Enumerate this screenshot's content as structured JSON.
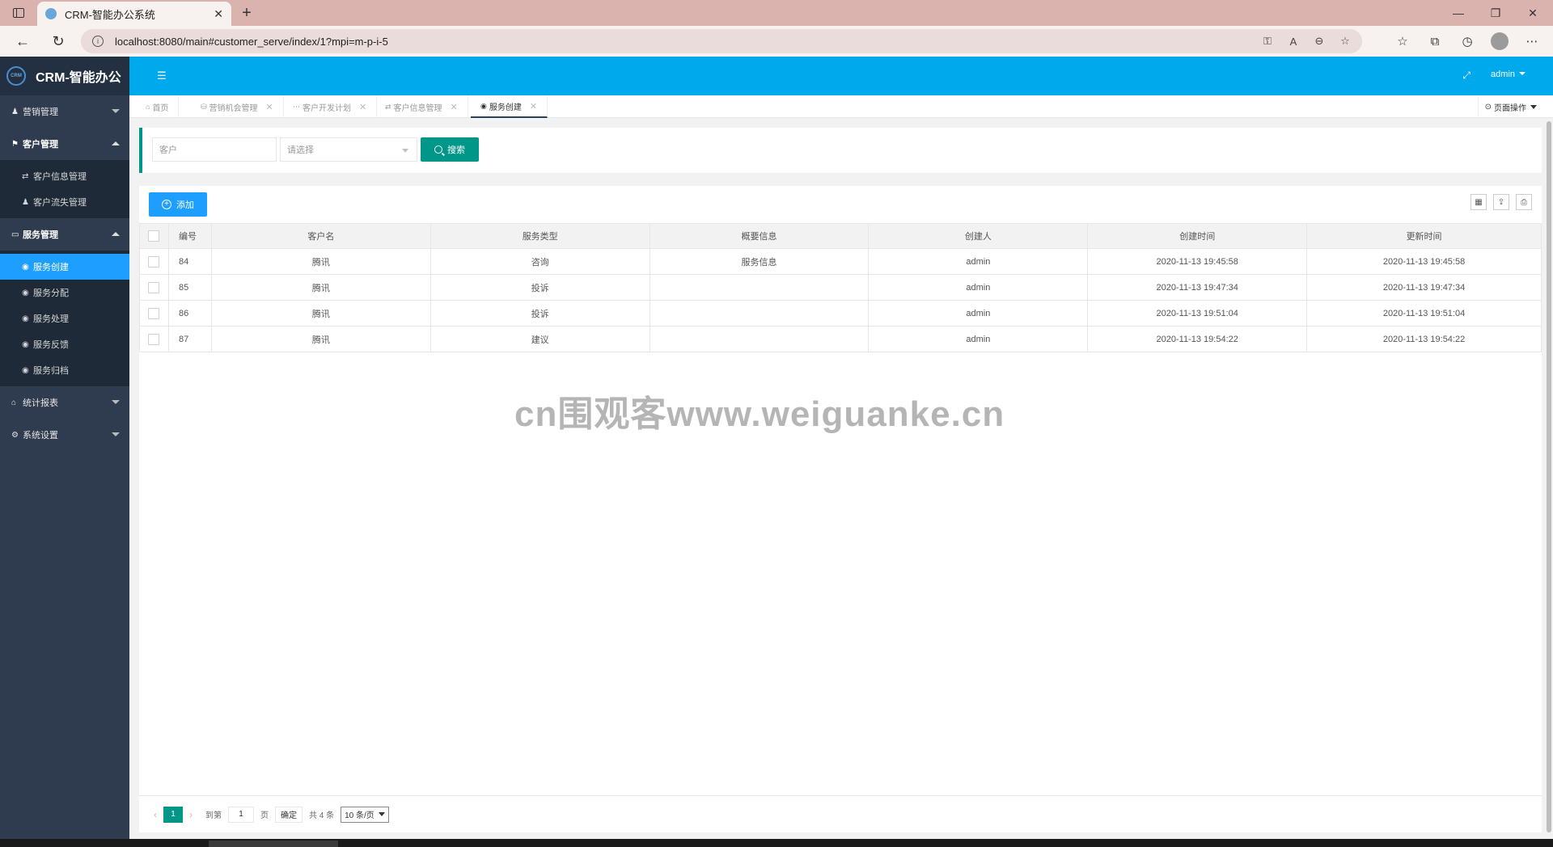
{
  "browser": {
    "tab_title": "CRM-智能办公系统",
    "url": "localhost:8080/main#customer_serve/index/1?mpi=m-p-i-5"
  },
  "app": {
    "logo_text": "CRM-智能办公",
    "logo_mark": "CRM",
    "user": "admin"
  },
  "sidebar": {
    "groups": [
      {
        "label": "营销管理",
        "icon": "user-icon"
      },
      {
        "label": "客户管理",
        "icon": "flag-icon",
        "items": [
          "客户信息管理",
          "客户流失管理"
        ]
      },
      {
        "label": "服务管理",
        "icon": "monitor-icon",
        "items": [
          "服务创建",
          "服务分配",
          "服务处理",
          "服务反馈",
          "服务归档"
        ]
      },
      {
        "label": "统计报表",
        "icon": "home-icon"
      },
      {
        "label": "系统设置",
        "icon": "gears-icon"
      }
    ],
    "active_item": "服务创建"
  },
  "tabs": [
    {
      "label": "首页"
    },
    {
      "label": "营销机会管理"
    },
    {
      "label": "客户开发计划"
    },
    {
      "label": "客户信息管理"
    },
    {
      "label": "服务创建"
    }
  ],
  "page_ops": "页面操作",
  "search": {
    "customer_placeholder": "客户",
    "type_placeholder": "请选择",
    "button": "搜索"
  },
  "toolbar": {
    "add": "添加"
  },
  "table": {
    "headers": [
      "编号",
      "客户名",
      "服务类型",
      "概要信息",
      "创建人",
      "创建时间",
      "更新时间"
    ],
    "rows": [
      [
        "84",
        "腾讯",
        "咨询",
        "服务信息",
        "admin",
        "2020-11-13 19:45:58",
        "2020-11-13 19:45:58"
      ],
      [
        "85",
        "腾讯",
        "投诉",
        "",
        "admin",
        "2020-11-13 19:47:34",
        "2020-11-13 19:47:34"
      ],
      [
        "86",
        "腾讯",
        "投诉",
        "",
        "admin",
        "2020-11-13 19:51:04",
        "2020-11-13 19:51:04"
      ],
      [
        "87",
        "腾讯",
        "建议",
        "",
        "admin",
        "2020-11-13 19:54:22",
        "2020-11-13 19:54:22"
      ]
    ]
  },
  "pager": {
    "current": "1",
    "goto_label": "到第",
    "goto_value": "1",
    "page_unit": "页",
    "confirm": "确定",
    "total": "共 4 条",
    "page_size": "10 条/页"
  },
  "watermark": "cn围观客www.weiguanke.cn"
}
